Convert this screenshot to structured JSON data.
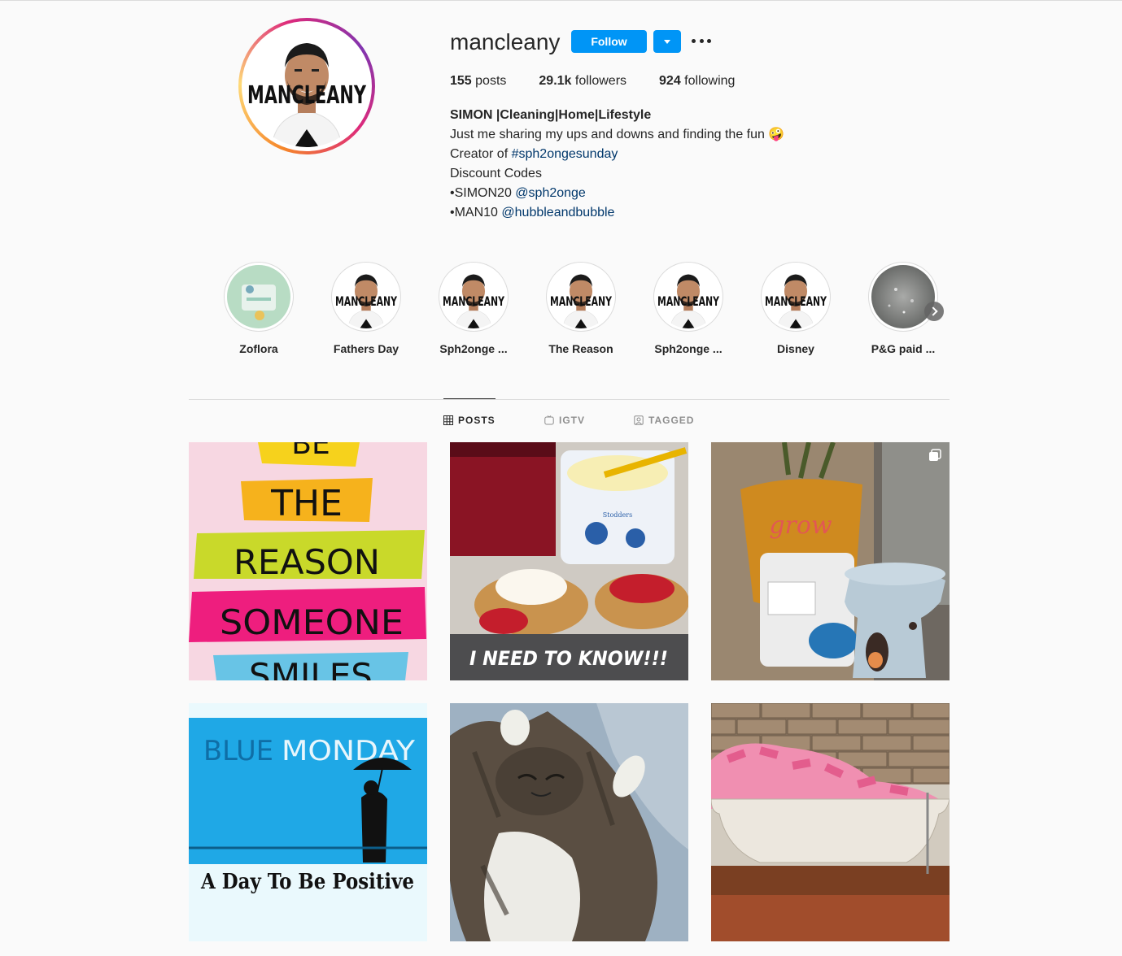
{
  "profile": {
    "username": "mancleany",
    "follow_label": "Follow",
    "avatar_text": "MANCLEANY"
  },
  "stats": {
    "posts_count": "155",
    "posts_label": " posts",
    "followers_count": "29.1k",
    "followers_label": " followers",
    "following_count": "924",
    "following_label": " following"
  },
  "bio": {
    "name": "SIMON |Cleaning|Home|Lifestyle",
    "line1": "Just me sharing my ups and downs and finding the fun 🤪",
    "line2_prefix": "Creator of ",
    "line2_link": "#sph2ongesunday",
    "line3": "Discount Codes",
    "line4_prefix": "•SIMON20 ",
    "line4_link": "@sph2onge",
    "line5_prefix": "•MAN10 ",
    "line5_link": "@hubbleandbubble"
  },
  "highlights": [
    {
      "label": "Zoflora"
    },
    {
      "label": "Fathers Day"
    },
    {
      "label": "Sph2onge ..."
    },
    {
      "label": "The Reason"
    },
    {
      "label": "Sph2onge ..."
    },
    {
      "label": "Disney"
    },
    {
      "label": "P&G paid ..."
    }
  ],
  "tabs": {
    "posts": "POSTS",
    "igtv": "IGTV",
    "tagged": "TAGGED"
  },
  "posts": [
    {
      "lines": [
        "BE",
        "THE",
        "REASON",
        "SOMEONE",
        "SMILES"
      ]
    },
    {
      "caption": "I NEED TO KNOW!!!",
      "pot_label": "Stodders"
    },
    {
      "pot_word": "grow"
    },
    {
      "title_a": "BLUE",
      "title_b": "MONDAY",
      "subtitle": "A Day To Be Positive"
    },
    {},
    {}
  ],
  "colors": {
    "accent": "#0095f6",
    "link": "#00376b",
    "text": "#262626",
    "muted": "#8e8e8e",
    "border": "#dbdbdb"
  }
}
